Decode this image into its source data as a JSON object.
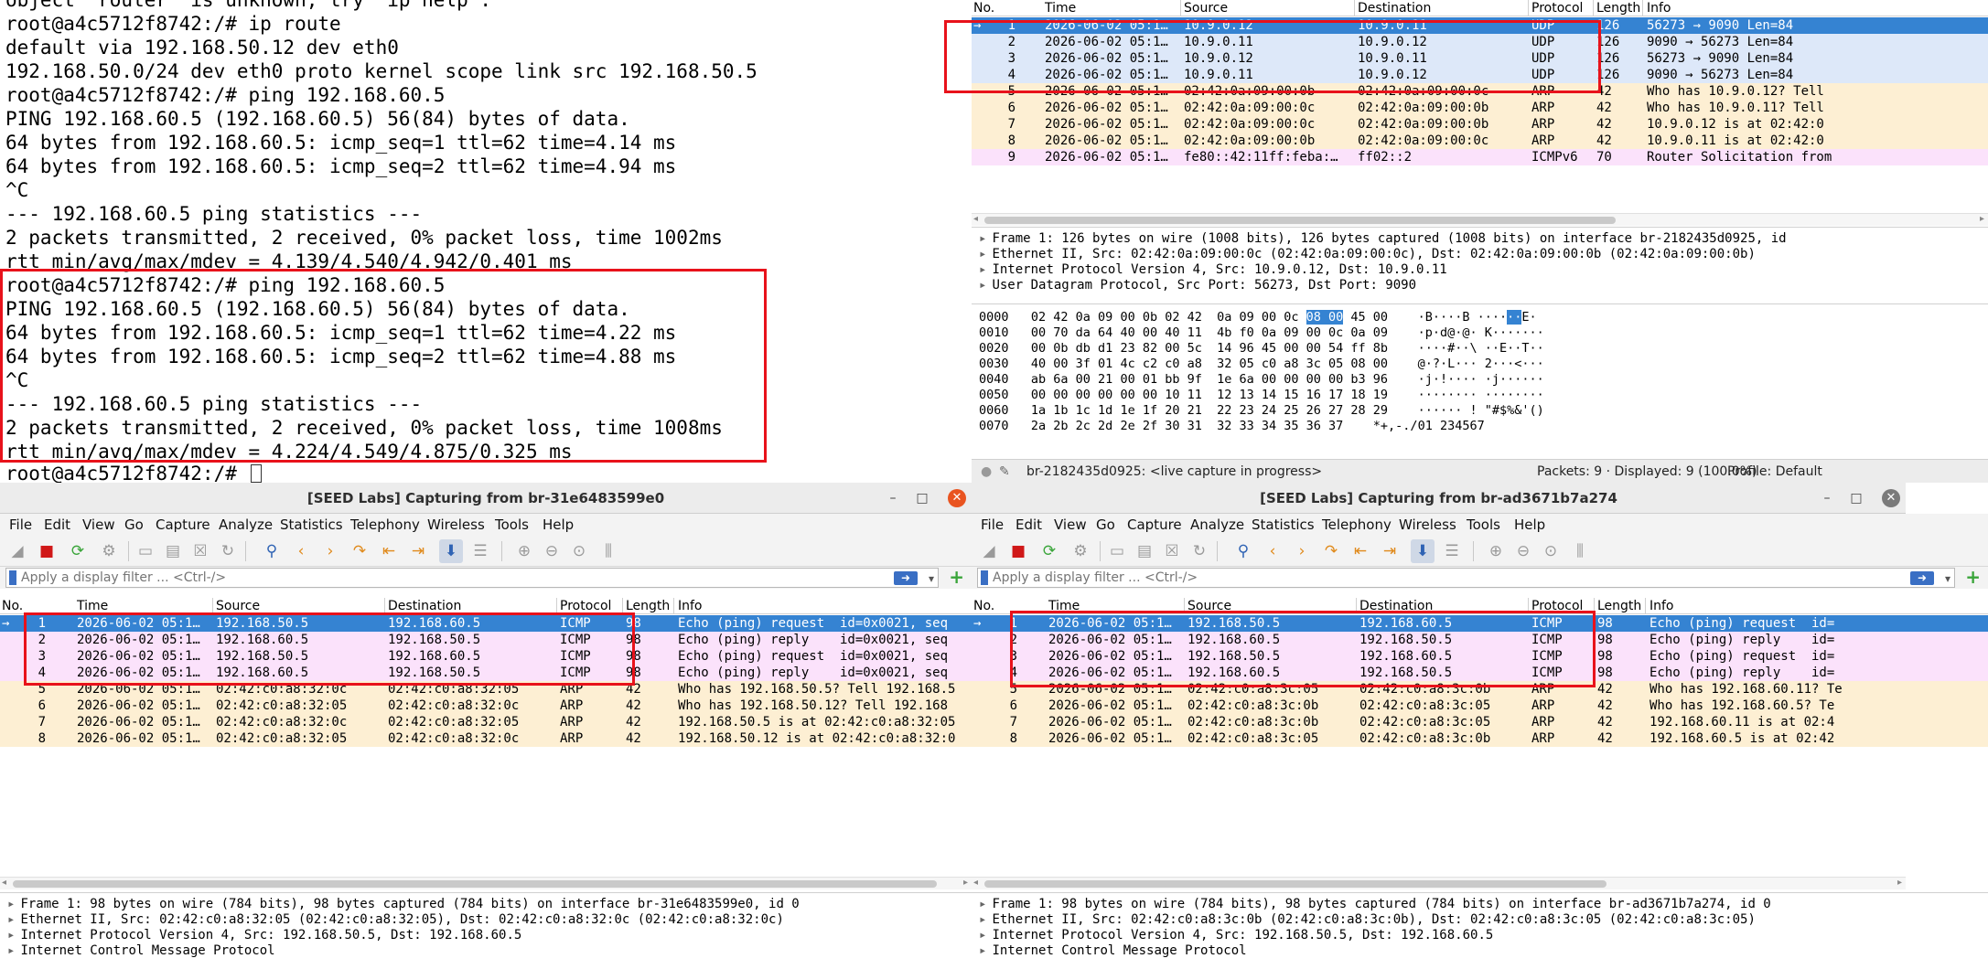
{
  "terminal": {
    "lines": [
      "object \"router\" is unknown, try \"ip help\".",
      "root@a4c5712f8742:/# ip route",
      "default via 192.168.50.12 dev eth0",
      "192.168.50.0/24 dev eth0 proto kernel scope link src 192.168.50.5",
      "root@a4c5712f8742:/# ping 192.168.60.5",
      "PING 192.168.60.5 (192.168.60.5) 56(84) bytes of data.",
      "64 bytes from 192.168.60.5: icmp_seq=1 ttl=62 time=4.14 ms",
      "64 bytes from 192.168.60.5: icmp_seq=2 ttl=62 time=4.94 ms",
      "^C",
      "--- 192.168.60.5 ping statistics ---",
      "2 packets transmitted, 2 received, 0% packet loss, time 1002ms",
      "rtt min/avg/max/mdev = 4.139/4.540/4.942/0.401 ms",
      "root@a4c5712f8742:/# ping 192.168.60.5",
      "PING 192.168.60.5 (192.168.60.5) 56(84) bytes of data.",
      "64 bytes from 192.168.60.5: icmp_seq=1 ttl=62 time=4.22 ms",
      "64 bytes from 192.168.60.5: icmp_seq=2 ttl=62 time=4.88 ms",
      "^C",
      "--- 192.168.60.5 ping statistics ---",
      "2 packets transmitted, 2 received, 0% packet loss, time 1008ms",
      "rtt min/avg/max/mdev = 4.224/4.549/4.875/0.325 ms",
      "root@a4c5712f8742:/# "
    ]
  },
  "menu": [
    "File",
    "Edit",
    "View",
    "Go",
    "Capture",
    "Analyze",
    "Statistics",
    "Telephony",
    "Wireless",
    "Tools",
    "Help"
  ],
  "filter_placeholder": "Apply a display filter ... <Ctrl-/>",
  "columns": [
    "No.",
    "Time",
    "Source",
    "Destination",
    "Protocol",
    "Length",
    "Info"
  ],
  "colors": {
    "selected": "#3583d2",
    "icmp": "#fbe2fb",
    "arp": "#fdefd3",
    "udp": "#dde8f9",
    "highlight_box": "#e8121b"
  },
  "top_window": {
    "packets": [
      {
        "no": "1",
        "time": "2026-06-02 05:1…",
        "src": "10.9.0.12",
        "dst": "10.9.0.11",
        "proto": "UDP",
        "len": "126",
        "info": "56273 → 9090 Len=84",
        "kind": "sel"
      },
      {
        "no": "2",
        "time": "2026-06-02 05:1…",
        "src": "10.9.0.11",
        "dst": "10.9.0.12",
        "proto": "UDP",
        "len": "126",
        "info": "9090 → 56273 Len=84",
        "kind": "udp"
      },
      {
        "no": "3",
        "time": "2026-06-02 05:1…",
        "src": "10.9.0.12",
        "dst": "10.9.0.11",
        "proto": "UDP",
        "len": "126",
        "info": "56273 → 9090 Len=84",
        "kind": "udp"
      },
      {
        "no": "4",
        "time": "2026-06-02 05:1…",
        "src": "10.9.0.11",
        "dst": "10.9.0.12",
        "proto": "UDP",
        "len": "126",
        "info": "9090 → 56273 Len=84",
        "kind": "udp"
      },
      {
        "no": "5",
        "time": "2026-06-02 05:1…",
        "src": "02:42:0a:09:00:0b",
        "dst": "02:42:0a:09:00:0c",
        "proto": "ARP",
        "len": "42",
        "info": "Who has 10.9.0.12? Tell",
        "kind": "arp"
      },
      {
        "no": "6",
        "time": "2026-06-02 05:1…",
        "src": "02:42:0a:09:00:0c",
        "dst": "02:42:0a:09:00:0b",
        "proto": "ARP",
        "len": "42",
        "info": "Who has 10.9.0.11? Tell",
        "kind": "arp"
      },
      {
        "no": "7",
        "time": "2026-06-02 05:1…",
        "src": "02:42:0a:09:00:0c",
        "dst": "02:42:0a:09:00:0b",
        "proto": "ARP",
        "len": "42",
        "info": "10.9.0.12 is at 02:42:0",
        "kind": "arp"
      },
      {
        "no": "8",
        "time": "2026-06-02 05:1…",
        "src": "02:42:0a:09:00:0b",
        "dst": "02:42:0a:09:00:0c",
        "proto": "ARP",
        "len": "42",
        "info": "10.9.0.11 is at 02:42:0",
        "kind": "arp"
      },
      {
        "no": "9",
        "time": "2026-06-02 05:1…",
        "src": "fe80::42:11ff:feba:…",
        "dst": "ff02::2",
        "proto": "ICMPv6",
        "len": "70",
        "info": "Router Solicitation from",
        "kind": "icmp6"
      }
    ],
    "details": [
      "Frame 1: 126 bytes on wire (1008 bits), 126 bytes captured (1008 bits) on interface br-2182435d0925, id",
      "Ethernet II, Src: 02:42:0a:09:00:0c (02:42:0a:09:00:0c), Dst: 02:42:0a:09:00:0b (02:42:0a:09:00:0b)",
      "Internet Protocol Version 4, Src: 10.9.0.12, Dst: 10.9.0.11",
      "User Datagram Protocol, Src Port: 56273, Dst Port: 9090"
    ],
    "bytes": [
      {
        "off": "0000",
        "hex_a": "02 42 0a 09 00 0b 02 42  0a 09 00 0c ",
        "hex_hl": "08 00",
        "hex_b": " 45 00",
        "ascii_a": "·B····B ····",
        "ascii_hl": "··",
        "ascii_b": "E·"
      },
      {
        "off": "0010",
        "hex_a": "00 70 da 64 40 00 40 11  4b f0 0a 09 00 0c 0a 09",
        "hex_hl": "",
        "hex_b": "",
        "ascii_a": "·p·d@·@· K·······",
        "ascii_hl": "",
        "ascii_b": ""
      },
      {
        "off": "0020",
        "hex_a": "00 0b db d1 23 82 00 5c  14 96 45 00 00 54 ff 8b",
        "hex_hl": "",
        "hex_b": "",
        "ascii_a": "····#··\\ ··E··T··",
        "ascii_hl": "",
        "ascii_b": ""
      },
      {
        "off": "0030",
        "hex_a": "40 00 3f 01 4c c2 c0 a8  32 05 c0 a8 3c 05 08 00",
        "hex_hl": "",
        "hex_b": "",
        "ascii_a": "@·?·L··· 2···<···",
        "ascii_hl": "",
        "ascii_b": ""
      },
      {
        "off": "0040",
        "hex_a": "ab 6a 00 21 00 01 bb 9f  1e 6a 00 00 00 00 b3 96",
        "hex_hl": "",
        "hex_b": "",
        "ascii_a": "·j·!···· ·j······",
        "ascii_hl": "",
        "ascii_b": ""
      },
      {
        "off": "0050",
        "hex_a": "00 00 00 00 00 00 10 11  12 13 14 15 16 17 18 19",
        "hex_hl": "",
        "hex_b": "",
        "ascii_a": "········ ········",
        "ascii_hl": "",
        "ascii_b": ""
      },
      {
        "off": "0060",
        "hex_a": "1a 1b 1c 1d 1e 1f 20 21  22 23 24 25 26 27 28 29",
        "hex_hl": "",
        "hex_b": "",
        "ascii_a": "······ ! \"#$%&'()",
        "ascii_hl": "",
        "ascii_b": ""
      },
      {
        "off": "0070",
        "hex_a": "2a 2b 2c 2d 2e 2f 30 31  32 33 34 35 36 37",
        "hex_hl": "",
        "hex_b": "",
        "ascii_a": "*+,-./01 234567",
        "ascii_hl": "",
        "ascii_b": ""
      }
    ],
    "status_iface": "br-2182435d0925: <live capture in progress>",
    "status_packets": "Packets: 9 · Displayed: 9 (100.0%)",
    "status_profile": "Profile: Default"
  },
  "left_window": {
    "title": "[SEED Labs] Capturing from br-31e6483599e0",
    "packets": [
      {
        "no": "1",
        "time": "2026-06-02 05:1…",
        "src": "192.168.50.5",
        "dst": "192.168.60.5",
        "proto": "ICMP",
        "len": "98",
        "info": "Echo (ping) request  id=0x0021, seq",
        "kind": "sel"
      },
      {
        "no": "2",
        "time": "2026-06-02 05:1…",
        "src": "192.168.60.5",
        "dst": "192.168.50.5",
        "proto": "ICMP",
        "len": "98",
        "info": "Echo (ping) reply    id=0x0021, seq",
        "kind": "icmp"
      },
      {
        "no": "3",
        "time": "2026-06-02 05:1…",
        "src": "192.168.50.5",
        "dst": "192.168.60.5",
        "proto": "ICMP",
        "len": "98",
        "info": "Echo (ping) request  id=0x0021, seq",
        "kind": "icmp"
      },
      {
        "no": "4",
        "time": "2026-06-02 05:1…",
        "src": "192.168.60.5",
        "dst": "192.168.50.5",
        "proto": "ICMP",
        "len": "98",
        "info": "Echo (ping) reply    id=0x0021, seq",
        "kind": "icmp"
      },
      {
        "no": "5",
        "time": "2026-06-02 05:1…",
        "src": "02:42:c0:a8:32:0c",
        "dst": "02:42:c0:a8:32:05",
        "proto": "ARP",
        "len": "42",
        "info": "Who has 192.168.50.5? Tell 192.168.5",
        "kind": "arp"
      },
      {
        "no": "6",
        "time": "2026-06-02 05:1…",
        "src": "02:42:c0:a8:32:05",
        "dst": "02:42:c0:a8:32:0c",
        "proto": "ARP",
        "len": "42",
        "info": "Who has 192.168.50.12? Tell 192.168",
        "kind": "arp"
      },
      {
        "no": "7",
        "time": "2026-06-02 05:1…",
        "src": "02:42:c0:a8:32:0c",
        "dst": "02:42:c0:a8:32:05",
        "proto": "ARP",
        "len": "42",
        "info": "192.168.50.5 is at 02:42:c0:a8:32:05",
        "kind": "arp"
      },
      {
        "no": "8",
        "time": "2026-06-02 05:1…",
        "src": "02:42:c0:a8:32:05",
        "dst": "02:42:c0:a8:32:0c",
        "proto": "ARP",
        "len": "42",
        "info": "192.168.50.12 is at 02:42:c0:a8:32:0",
        "kind": "arp"
      }
    ],
    "details": [
      "Frame 1: 98 bytes on wire (784 bits), 98 bytes captured (784 bits) on interface br-31e6483599e0, id 0",
      "Ethernet II, Src: 02:42:c0:a8:32:05 (02:42:c0:a8:32:05), Dst: 02:42:c0:a8:32:0c (02:42:c0:a8:32:0c)",
      "Internet Protocol Version 4, Src: 192.168.50.5, Dst: 192.168.60.5",
      "Internet Control Message Protocol"
    ]
  },
  "right_window": {
    "title": "[SEED Labs] Capturing from br-ad3671b7a274",
    "packets": [
      {
        "no": "1",
        "time": "2026-06-02 05:1…",
        "src": "192.168.50.5",
        "dst": "192.168.60.5",
        "proto": "ICMP",
        "len": "98",
        "info": "Echo (ping) request  id=",
        "kind": "sel"
      },
      {
        "no": "2",
        "time": "2026-06-02 05:1…",
        "src": "192.168.60.5",
        "dst": "192.168.50.5",
        "proto": "ICMP",
        "len": "98",
        "info": "Echo (ping) reply    id=",
        "kind": "icmp"
      },
      {
        "no": "3",
        "time": "2026-06-02 05:1…",
        "src": "192.168.50.5",
        "dst": "192.168.60.5",
        "proto": "ICMP",
        "len": "98",
        "info": "Echo (ping) request  id=",
        "kind": "icmp"
      },
      {
        "no": "4",
        "time": "2026-06-02 05:1…",
        "src": "192.168.60.5",
        "dst": "192.168.50.5",
        "proto": "ICMP",
        "len": "98",
        "info": "Echo (ping) reply    id=",
        "kind": "icmp"
      },
      {
        "no": "5",
        "time": "2026-06-02 05:1…",
        "src": "02:42:c0:a8:3c:05",
        "dst": "02:42:c0:a8:3c:0b",
        "proto": "ARP",
        "len": "42",
        "info": "Who has 192.168.60.11? Te",
        "kind": "arp"
      },
      {
        "no": "6",
        "time": "2026-06-02 05:1…",
        "src": "02:42:c0:a8:3c:0b",
        "dst": "02:42:c0:a8:3c:05",
        "proto": "ARP",
        "len": "42",
        "info": "Who has 192.168.60.5? Te",
        "kind": "arp"
      },
      {
        "no": "7",
        "time": "2026-06-02 05:1…",
        "src": "02:42:c0:a8:3c:0b",
        "dst": "02:42:c0:a8:3c:05",
        "proto": "ARP",
        "len": "42",
        "info": "192.168.60.11 is at 02:4",
        "kind": "arp"
      },
      {
        "no": "8",
        "time": "2026-06-02 05:1…",
        "src": "02:42:c0:a8:3c:05",
        "dst": "02:42:c0:a8:3c:0b",
        "proto": "ARP",
        "len": "42",
        "info": "192.168.60.5 is at 02:42",
        "kind": "arp"
      }
    ],
    "details": [
      "Frame 1: 98 bytes on wire (784 bits), 98 bytes captured (784 bits) on interface br-ad3671b7a274, id 0",
      "Ethernet II, Src: 02:42:c0:a8:3c:0b (02:42:c0:a8:3c:0b), Dst: 02:42:c0:a8:3c:05 (02:42:c0:a8:3c:05)",
      "Internet Protocol Version 4, Src: 192.168.50.5, Dst: 192.168.60.5",
      "Internet Control Message Protocol"
    ]
  }
}
